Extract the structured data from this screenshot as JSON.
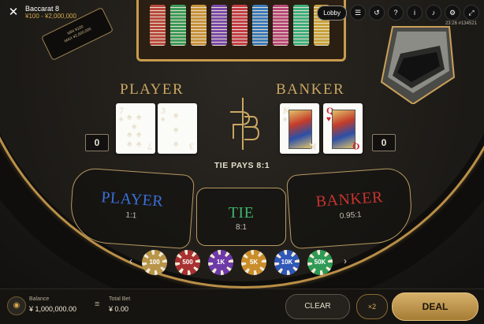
{
  "header": {
    "title": "Baccarat 8",
    "limits": "¥100 - ¥2,000,000",
    "lobby_label": "Lobby",
    "round_info": "23:26  #134521",
    "icons": [
      "menu-icon",
      "history-icon",
      "help-icon",
      "info-icon",
      "sound-icon",
      "settings-icon",
      "fullscreen-icon"
    ]
  },
  "limit_sign": {
    "min": "MIN ¥100",
    "max": "MAX ¥2,000,000"
  },
  "tray_colors": [
    "#b84a3d",
    "#3d9a5a",
    "#c8923c",
    "#7a4aa8",
    "#c23e47",
    "#3c7ab8",
    "#b84a78",
    "#3fae7d",
    "#c8a23c"
  ],
  "player": {
    "label": "PLAYER",
    "score": "0",
    "cards": [
      {
        "rank": "7",
        "suit": "♠",
        "color": "#111"
      },
      {
        "rank": "3",
        "suit": "♠",
        "color": "#111"
      }
    ]
  },
  "banker": {
    "label": "BANKER",
    "score": "0",
    "cards": [
      {
        "rank": "K",
        "suit": "♠",
        "color": "#111"
      },
      {
        "rank": "Q",
        "suit": "♥",
        "color": "#c9242c"
      }
    ]
  },
  "tie_pays": "TIE PAYS 8:1",
  "bets": {
    "player": {
      "label": "PLAYER",
      "payout": "1:1",
      "color": "#3a6fd8"
    },
    "tie": {
      "label": "TIE",
      "payout": "8:1",
      "color": "#3fb36b"
    },
    "banker": {
      "label": "BANKER",
      "payout": "0.95:1",
      "color": "#c8332f"
    }
  },
  "chips": [
    {
      "value": "100",
      "color": "#b8954a"
    },
    {
      "value": "500",
      "color": "#a83232"
    },
    {
      "value": "1K",
      "color": "#6e3aa8"
    },
    {
      "value": "5K",
      "color": "#c98e2b"
    },
    {
      "value": "10K",
      "color": "#2f58b8"
    },
    {
      "value": "50K",
      "color": "#2f9a55"
    }
  ],
  "chip_nav": {
    "prev": "‹",
    "next": "›"
  },
  "footer": {
    "balance_label": "Balance",
    "balance_value": "¥ 1,000,000.00",
    "total_bet_label": "Total Bet",
    "total_bet_value": "¥ 0.00",
    "clear_label": "CLEAR",
    "double_label": "×2",
    "deal_label": "DEAL"
  }
}
